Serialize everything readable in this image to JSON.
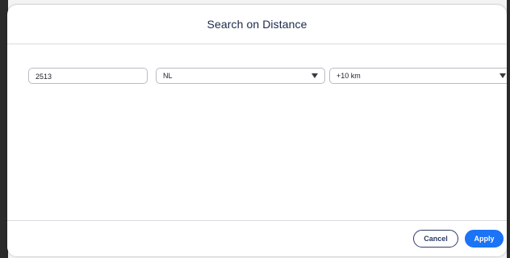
{
  "dialog": {
    "title": "Search on Distance"
  },
  "form": {
    "postcode": {
      "value": "2513",
      "placeholder": ""
    },
    "country": {
      "selected": "NL"
    },
    "distance": {
      "selected": "+10 km"
    }
  },
  "footer": {
    "cancel_label": "Cancel",
    "apply_label": "Apply"
  },
  "icons": {
    "dropdown": "chevron-down-icon"
  },
  "colors": {
    "primary": "#1b73f5",
    "secondary_text": "#2b3c63",
    "title_text": "#1a2a4a"
  }
}
